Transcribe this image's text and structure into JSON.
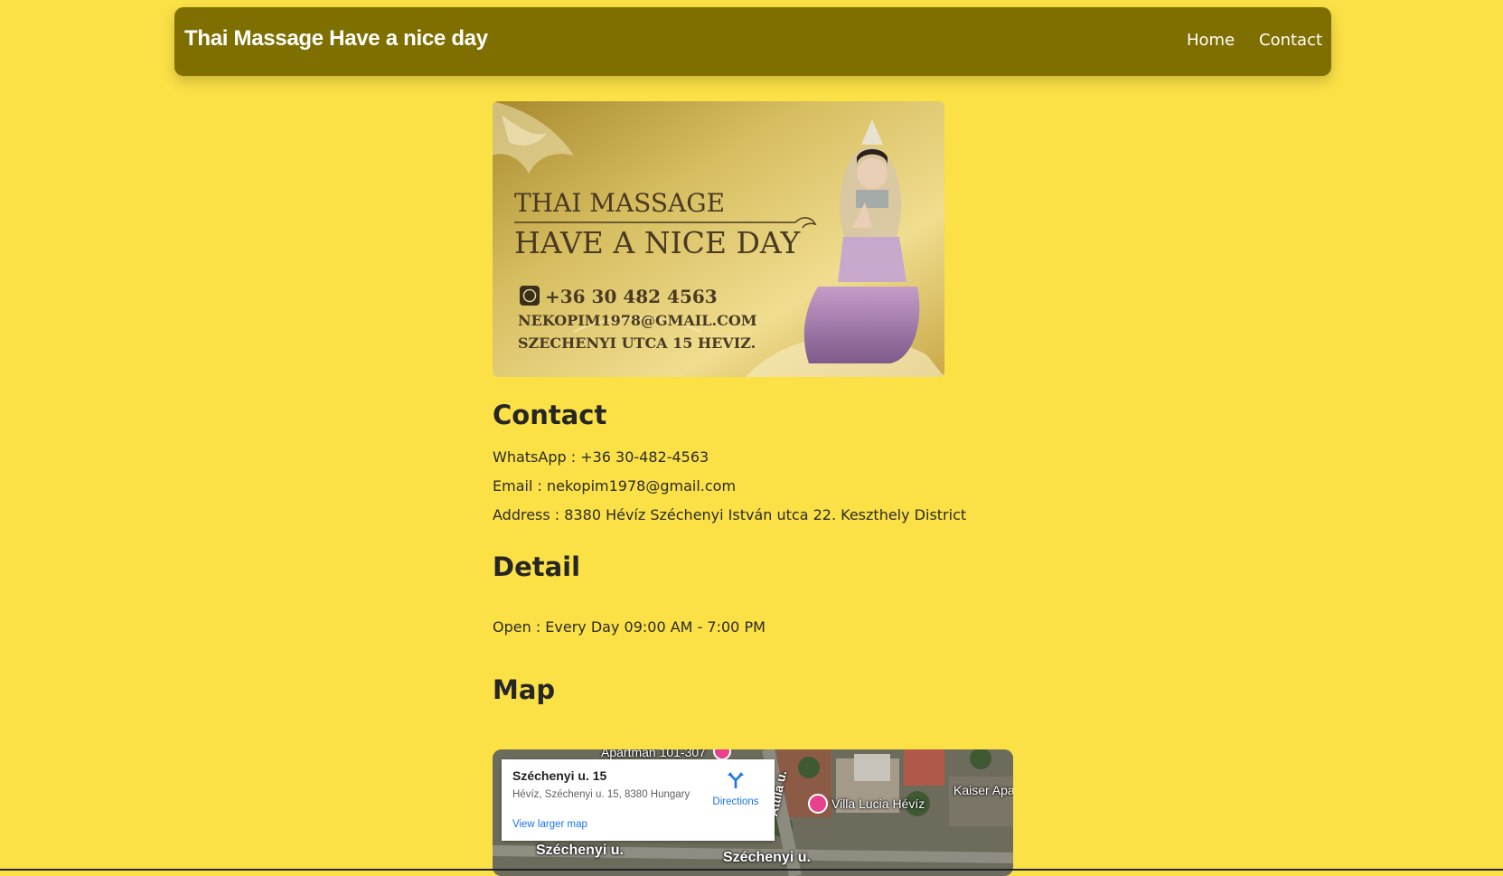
{
  "navbar": {
    "brand": "Thai Massage Have a nice day",
    "links": [
      "Home",
      "Contact"
    ]
  },
  "banner": {
    "line1": "THAI MASSAGE",
    "line2": "HAVE A NICE DAY",
    "phone": "+36 30 482 4563",
    "email": "NEKOPIM1978@GMAIL.COM",
    "address": "SZECHENYI UTCA 15 HEVIZ."
  },
  "contact": {
    "heading": "Contact",
    "whatsapp": "WhatsApp : +36 30-482-4563",
    "email": "Email : nekopim1978@gmail.com",
    "address": "Address : 8380 Hévíz Széchenyi István utca 22. Keszthely District"
  },
  "detail": {
    "heading": "Detail",
    "open": "Open : Every Day 09:00 AM - 7:00 PM"
  },
  "map": {
    "heading": "Map",
    "card_title": "Széchenyi u. 15",
    "card_address": "Hévíz, Széchenyi u. 15, 8380 Hungary",
    "directions": "Directions",
    "view_larger": "View larger map",
    "labels": {
      "villa": "Villa Lucia Hévíz",
      "kaiser": "Kaiser Apa",
      "street1": "Széchenyi u.",
      "street2": "Széchenyi u.",
      "attila": "Attila u.",
      "top_partial": "Apartman 101-307"
    }
  },
  "colors": {
    "page_bg": "#fbe046",
    "navbar_bg": "#7f6f00",
    "link_blue": "#1a73e8",
    "pin_pink": "#e8418e"
  }
}
